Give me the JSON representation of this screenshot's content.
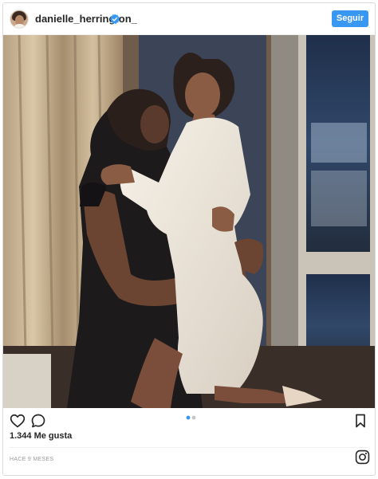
{
  "post": {
    "username": "danielle_herrington_",
    "verified_icon": "verified-badge-icon",
    "follow_label": "Seguir",
    "image": {
      "kind": "photo",
      "content": "two women hugging and kissing, one in white fitted dress and one in black dress, indoor room with curtains and window"
    },
    "carousel": {
      "current": 1,
      "total": 2
    },
    "likes_text": "1.344 Me gusta",
    "timestamp": "HACE 9 MESES",
    "icons": {
      "like": "heart-icon",
      "comment": "comment-icon",
      "save": "bookmark-icon",
      "brand": "instagram-logo-icon"
    }
  },
  "colors": {
    "accent": "#3897f0",
    "text": "#262626",
    "muted": "#999999",
    "border": "#dbdbdb"
  }
}
